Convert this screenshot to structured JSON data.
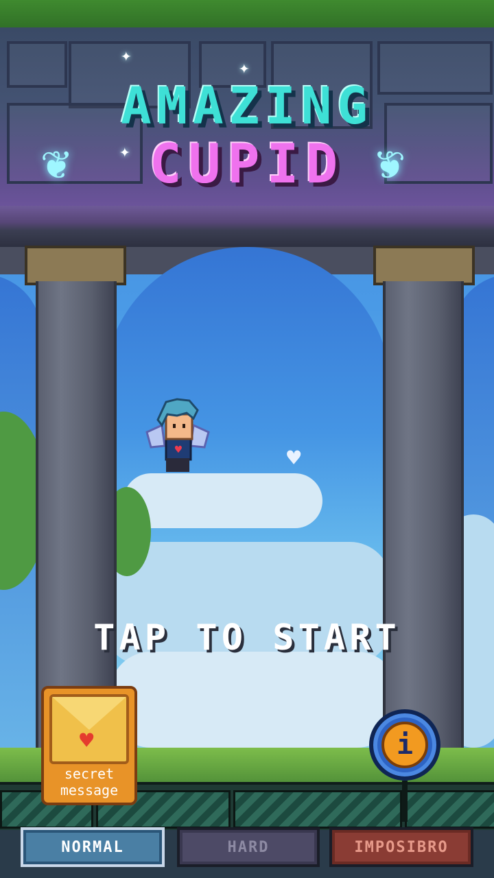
{
  "game": {
    "title_line1": "AMAZING",
    "title_line2": "CUPID",
    "prompt": "TAP TO START"
  },
  "buttons": {
    "secret_message_line1": "secret",
    "secret_message_line2": "message",
    "info_label": "i"
  },
  "difficulty": {
    "options": [
      "NORMAL",
      "HARD",
      "IMPOSIBRO"
    ],
    "selected": "NORMAL"
  },
  "icons": {
    "wing_left": "wing-icon",
    "wing_right": "wing-icon",
    "envelope": "envelope-heart-icon",
    "info": "info-icon",
    "heart": "heart-icon"
  }
}
